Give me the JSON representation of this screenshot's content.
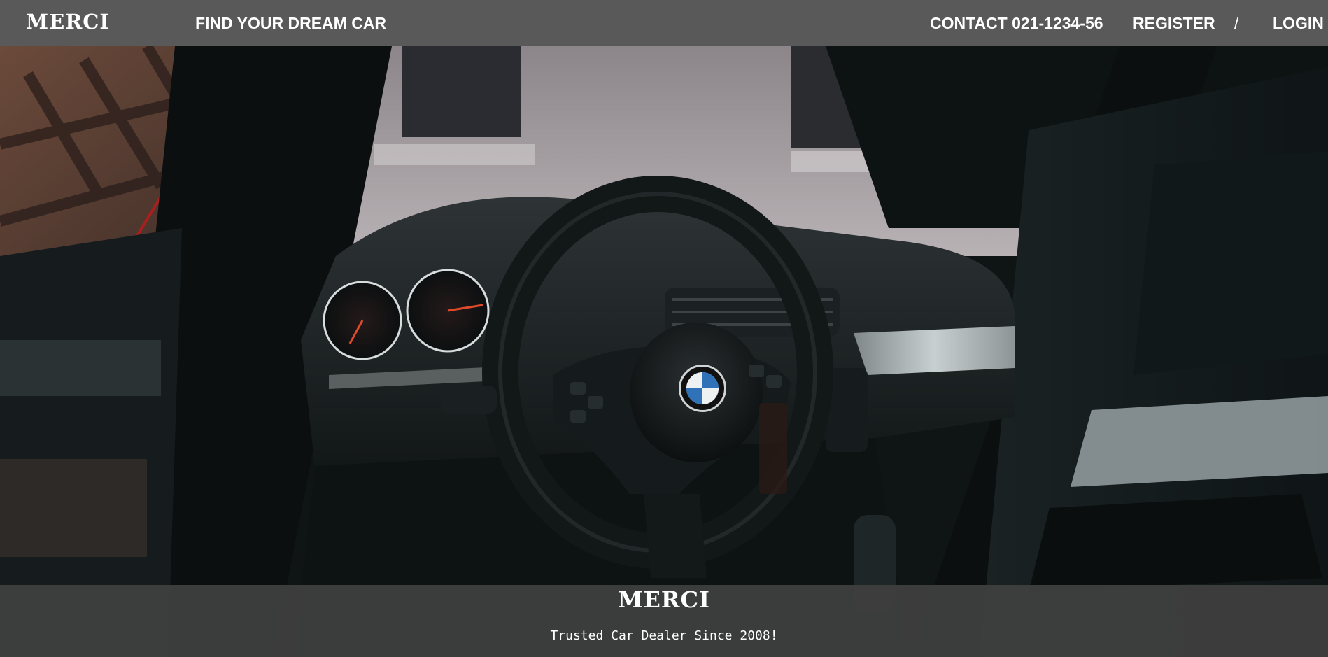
{
  "navbar": {
    "logo": "MERCI",
    "find_link": "FIND YOUR DREAM CAR",
    "contact_link": "CONTACT 021-1234-56",
    "register_link": "REGISTER",
    "separator": "/",
    "login_link": "LOGIN",
    "background_color": "#595959"
  },
  "hero": {
    "subject": "car-interior-steering-wheel-photo",
    "badge_icon": "bmw-logo-icon"
  },
  "footer": {
    "brand": "MERCI",
    "tagline": "Trusted Car Dealer Since 2008!",
    "background_color": "#404040"
  }
}
